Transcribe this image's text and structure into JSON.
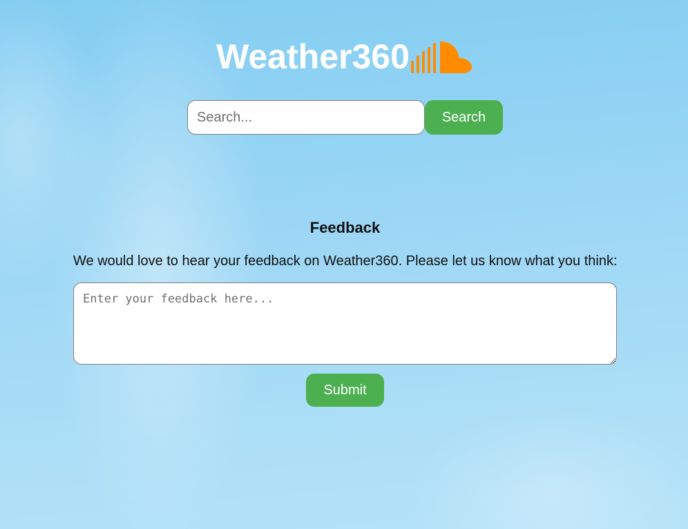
{
  "header": {
    "logo_text": "Weather360",
    "logo_icon": "soundcloud-cloud-icon",
    "logo_icon_color": "#ff8c00"
  },
  "search": {
    "placeholder": "Search...",
    "value": "",
    "button_label": "Search"
  },
  "feedback": {
    "title": "Feedback",
    "description": "We would love to hear your feedback on Weather360. Please let us know what you think:",
    "textarea_placeholder": "Enter your feedback here...",
    "textarea_value": "",
    "submit_label": "Submit"
  },
  "colors": {
    "accent": "#4caf50",
    "button_text": "#ffffff",
    "logo_text": "#ffffff"
  }
}
